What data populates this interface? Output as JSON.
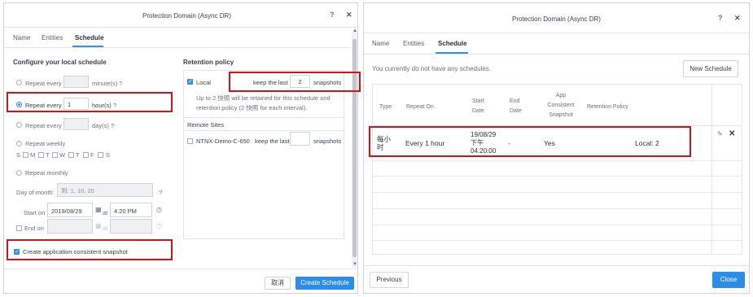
{
  "left": {
    "title": "Protection Domain (Async DR)",
    "help_icon": "?",
    "close_icon": "✕",
    "tabs": [
      "Name",
      "Entities",
      "Schedule"
    ],
    "local": {
      "heading": "Configure your local schedule",
      "repeat_minutes": {
        "label": "Repeat every",
        "value": "",
        "unit": "minute(s)",
        "help": "?"
      },
      "repeat_hours": {
        "label": "Repeat every",
        "value": "1",
        "unit": "hour(s)",
        "help": "?"
      },
      "repeat_days": {
        "label": "Repeat every",
        "value": "",
        "unit": "day(s)",
        "help": "?"
      },
      "repeat_weekly": "Repeat weekly",
      "weekdays": [
        "S",
        "M",
        "T",
        "W",
        "T",
        "F",
        "S"
      ],
      "repeat_monthly": "Repeat monthly",
      "day_of_month_label": "Day of month:",
      "day_of_month_placeholder": "到: 1, 10, 20",
      "day_of_month_help": "?",
      "start_on_label": "Start on",
      "start_date": "2019/08/29",
      "at_label": "at",
      "start_time": "4:20 PM",
      "end_on_label": "End on",
      "end_at_label": "at",
      "consistent_snapshot": "Create application consistent snapshot"
    },
    "retention": {
      "heading": "Retention policy",
      "local_label": "Local",
      "keep_last": "keep the last",
      "local_count": "2",
      "snapshots": "snapshots",
      "note": "Up to 2 快照 will be retained for this schedule and retention policy (2 快照 for each interval).",
      "remote_heading": "Remote Sites",
      "remote_name": "NTNX-Demo-C-650",
      "remote_keep": "keep the last",
      "remote_count": "",
      "remote_snapshots": "snapshots"
    },
    "cancel_label": "取消",
    "create_label": "Create Schedule"
  },
  "right": {
    "title": "Protection Domain (Async DR)",
    "help_icon": "?",
    "close_icon": "✕",
    "tabs": [
      "Name",
      "Entities",
      "Schedule"
    ],
    "empty_note": "You currently do not have any schedules.",
    "new_schedule_label": "New Schedule",
    "columns": [
      "Type",
      "Repeat On",
      "Start Date",
      "End Date",
      "App Consistent Snapshot",
      "Retention Policy"
    ],
    "row": {
      "type": "每小时",
      "repeat_on": "Every 1 hour",
      "start_date": "19/08/29 下午 04:20:00",
      "end_date": "-",
      "app_consistent": "Yes",
      "retention": "Local: 2"
    },
    "previous_label": "Previous",
    "close_label": "Close"
  }
}
